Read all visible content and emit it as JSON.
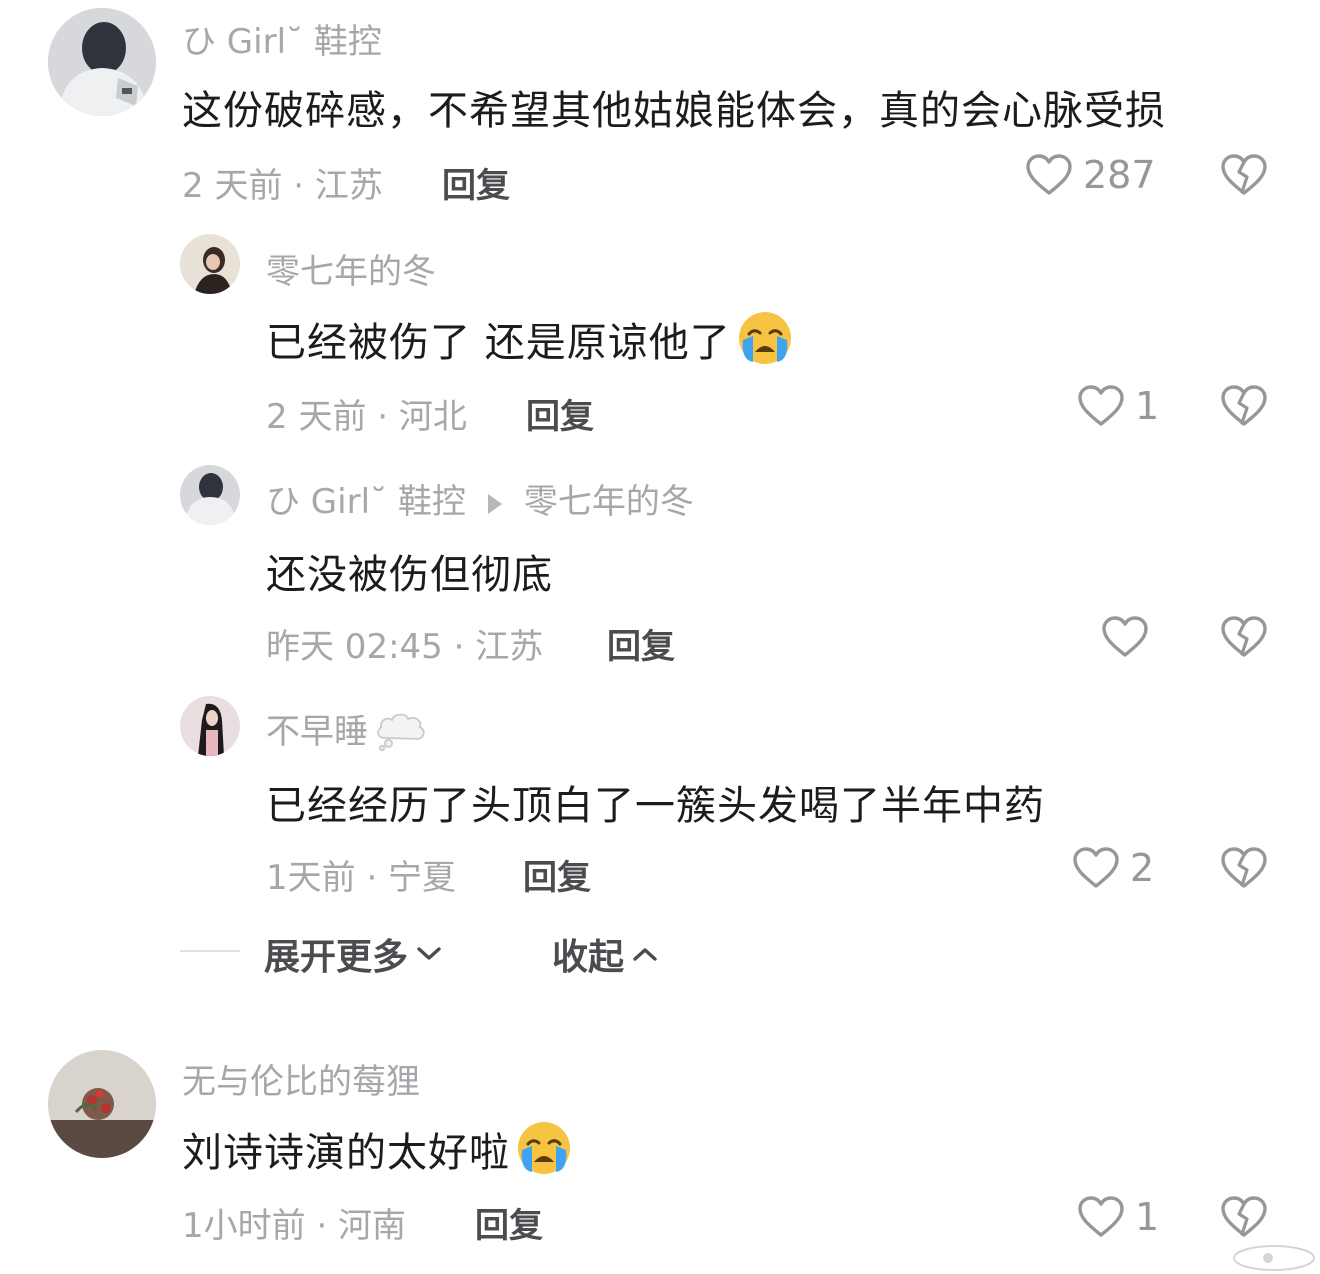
{
  "comments": [
    {
      "user": "ひ Girl˘   鞋控",
      "content": "这份破碎感，不希望其他姑娘能体会，真的会心脉受损",
      "meta": "2 天前 · 江苏",
      "reply": "回复",
      "likes": "287",
      "replies": [
        {
          "user": "零七年的冬",
          "content": "已经被伤了 还是原谅他了",
          "emoji": "loudly-crying-face",
          "meta": "2 天前 · 河北",
          "reply": "回复",
          "likes": "1"
        },
        {
          "user": "ひ Girl˘   鞋控",
          "reply_to": "零七年的冬",
          "content": "还没被伤但彻底",
          "meta": "昨天 02:45 · 江苏",
          "reply": "回复",
          "likes": ""
        },
        {
          "user": "不早睡",
          "user_badge": "thought-cloud",
          "content": "已经经历了头顶白了一簇头发喝了半年中药",
          "meta": "1天前 · 宁夏",
          "reply": "回复",
          "likes": "2"
        }
      ],
      "expand_label": "展开更多",
      "collapse_label": "收起"
    },
    {
      "user": "无与伦比的莓狸",
      "content": "刘诗诗演的太好啦",
      "emoji": "loudly-crying-face",
      "meta": "1小时前 · 河南",
      "reply": "回复",
      "likes": "1"
    }
  ],
  "colors": {
    "username": "#a7a7ab",
    "content": "#1c1c1e",
    "meta": "#a7a7ab",
    "reply": "#4c4c50",
    "icon": "#97979b"
  }
}
